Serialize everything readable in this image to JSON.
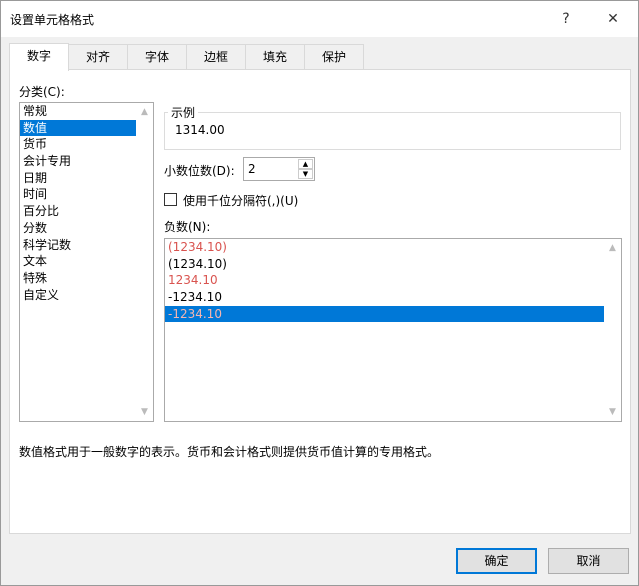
{
  "dialog": {
    "title": "设置单元格格式",
    "help": "?",
    "close": "✕"
  },
  "tabs": [
    "数字",
    "对齐",
    "字体",
    "边框",
    "填充",
    "保护"
  ],
  "category": {
    "label": "分类(C):",
    "items": [
      "常规",
      "数值",
      "货币",
      "会计专用",
      "日期",
      "时间",
      "百分比",
      "分数",
      "科学记数",
      "文本",
      "特殊",
      "自定义"
    ],
    "selected": 1
  },
  "sample": {
    "label": "示例",
    "value": "1314.00"
  },
  "decimals": {
    "label": "小数位数(D):",
    "value": "2"
  },
  "thousands": {
    "label": "使用千位分隔符(,)(U)",
    "checked": false
  },
  "negative": {
    "label": "负数(N):",
    "items": [
      {
        "text": "(1234.10)",
        "red": true
      },
      {
        "text": "(1234.10)",
        "red": false
      },
      {
        "text": "1234.10",
        "red": true
      },
      {
        "text": "-1234.10",
        "red": false
      },
      {
        "text": "-1234.10",
        "red": false
      }
    ],
    "selected": 4
  },
  "description": "数值格式用于一般数字的表示。货币和会计格式则提供货币值计算的专用格式。",
  "buttons": {
    "ok": "确定",
    "cancel": "取消"
  },
  "colors": {
    "accent": "#0078d7",
    "negative_red": "#d9534f"
  }
}
